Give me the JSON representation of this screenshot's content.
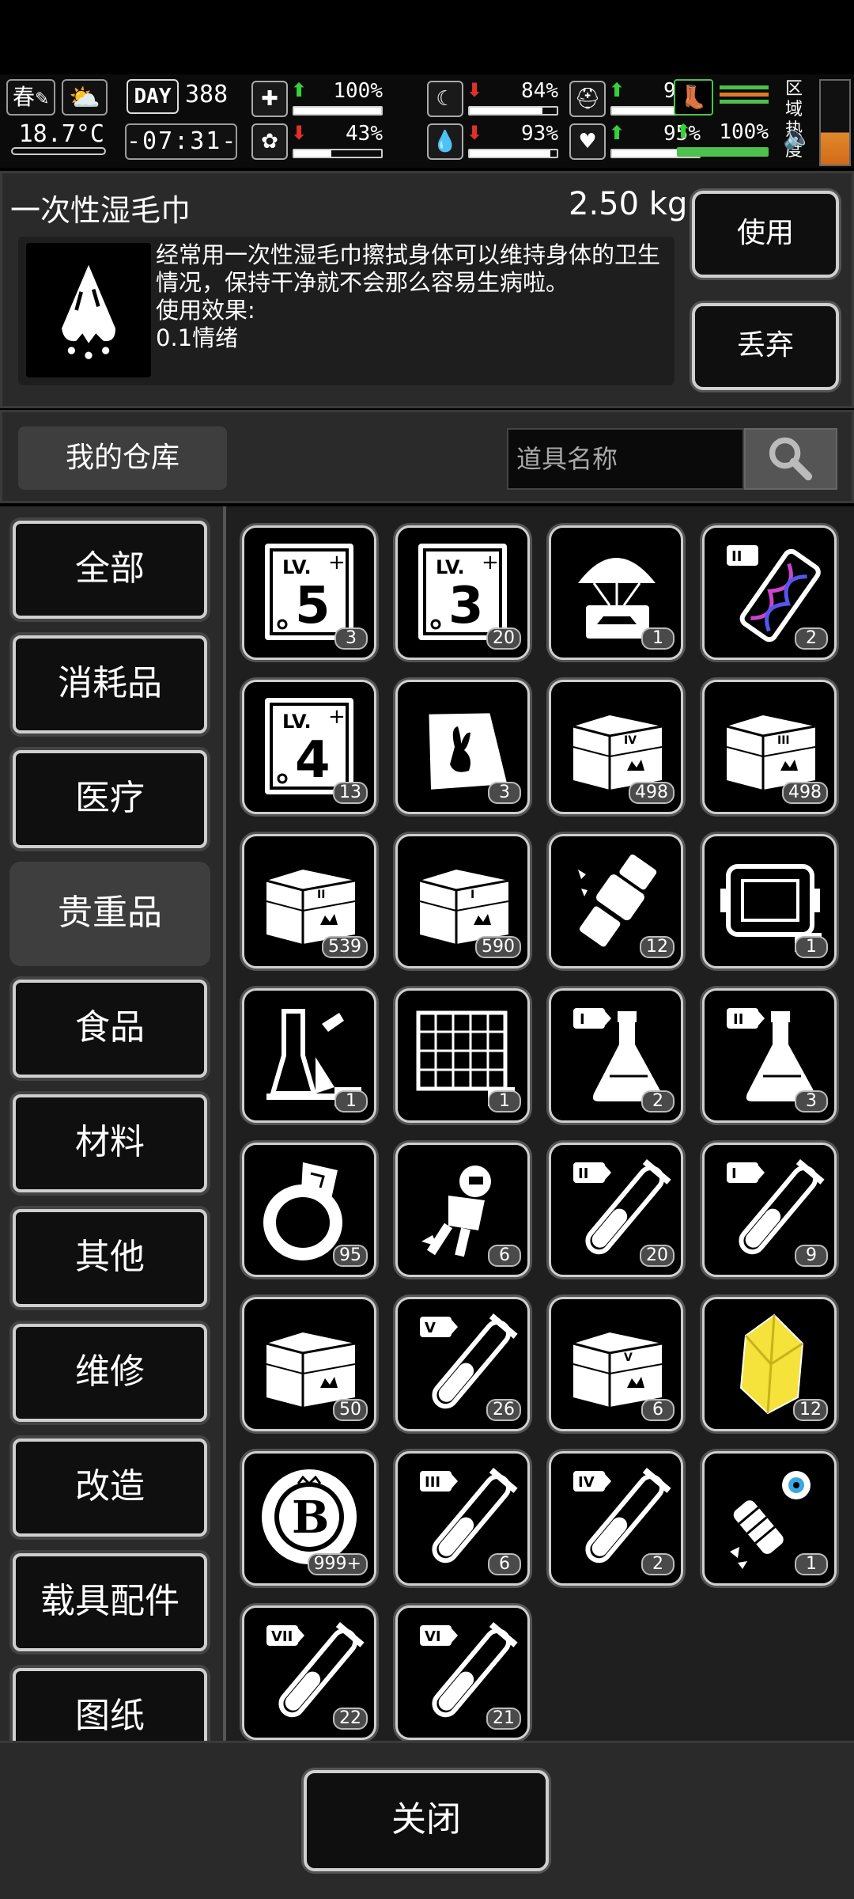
{
  "status": {
    "season": "春",
    "weather_icon": "cloudy-sun-icon",
    "temperature": "18.7°C",
    "day_label": "DAY",
    "day_value": "388",
    "clock": "-07:31-",
    "stats": [
      {
        "icon": "medkit-icon",
        "trend": "up",
        "percent": "100%",
        "level": 1.0
      },
      {
        "icon": "stomach-icon",
        "trend": "down",
        "percent": "84%",
        "level": 0.84
      },
      {
        "icon": "helmet-icon",
        "trend": "up",
        "percent": "92%",
        "level": 0.92
      },
      {
        "icon": "brain-icon",
        "trend": "down",
        "percent": "43%",
        "level": 0.43
      },
      {
        "icon": "water-drop-icon",
        "trend": "down",
        "percent": "93%",
        "level": 0.93
      },
      {
        "icon": "heart-icon",
        "trend": "up",
        "percent": "95%",
        "level": 0.95
      }
    ],
    "stamina": {
      "icon": "boot-icon",
      "trend": "up",
      "percent": "100%",
      "level": 1.0
    },
    "region_label": "区域热度",
    "sound_icon": "speaker-icon",
    "colors": {
      "up": "#37d03a",
      "down": "#e0302a",
      "stamina": "#4dc04d"
    }
  },
  "item": {
    "name": "一次性湿毛巾",
    "weight": "2.50 kg",
    "description": "经常用一次性湿毛巾擦拭身体可以维持身体的卫生情况，保持干净就不会那么容易生病啦。",
    "effect_label": "使用效果:",
    "effect_value": "0.1情绪",
    "use_label": "使用",
    "drop_label": "丢弃"
  },
  "warehouse": {
    "title": "我的仓库",
    "search_placeholder": "道具名称"
  },
  "categories": [
    "全部",
    "消耗品",
    "医疗",
    "贵重品",
    "食品",
    "材料",
    "其他",
    "维修",
    "改造",
    "载具配件",
    "图纸"
  ],
  "active_category": "贵重品",
  "items": [
    {
      "icon": "level-up-ticket-5-icon",
      "count": "3",
      "glyph": "5"
    },
    {
      "icon": "level-up-ticket-3-icon",
      "count": "20",
      "glyph": "3"
    },
    {
      "icon": "airdrop-car-icon",
      "count": "1"
    },
    {
      "icon": "dna-capsule-ii-icon",
      "count": "2"
    },
    {
      "icon": "level-up-ticket-4-icon",
      "count": "13",
      "glyph": "4"
    },
    {
      "icon": "rabbit-bag-icon",
      "count": "3"
    },
    {
      "icon": "crate-iv-icon",
      "count": "498"
    },
    {
      "icon": "crate-iii-icon",
      "count": "498"
    },
    {
      "icon": "crate-ii-icon",
      "count": "539"
    },
    {
      "icon": "crate-i-icon",
      "count": "590"
    },
    {
      "icon": "broken-canister-icon",
      "count": "12"
    },
    {
      "icon": "machine-blueprint-icon",
      "count": "1"
    },
    {
      "icon": "lab-flask-blueprint-icon",
      "count": "1"
    },
    {
      "icon": "grid-blueprint-icon",
      "count": "1"
    },
    {
      "icon": "flask-i-icon",
      "count": "2"
    },
    {
      "icon": "flask-ii-icon",
      "count": "3"
    },
    {
      "icon": "crown-ring-icon",
      "count": "95"
    },
    {
      "icon": "astronaut-icon",
      "count": "6"
    },
    {
      "icon": "test-tube-ii-icon",
      "count": "20"
    },
    {
      "icon": "test-tube-i-icon",
      "count": "9"
    },
    {
      "icon": "crate-special-icon",
      "count": "50"
    },
    {
      "icon": "test-tube-v-icon",
      "count": "26"
    },
    {
      "icon": "crate-v-icon",
      "count": "6"
    },
    {
      "icon": "yellow-crystal-icon",
      "count": "12"
    },
    {
      "icon": "bitcoin-chip-icon",
      "count": "999+",
      "glyph": "B"
    },
    {
      "icon": "test-tube-iii-icon",
      "count": "6"
    },
    {
      "icon": "test-tube-iv-icon",
      "count": "2"
    },
    {
      "icon": "robot-arm-eye-icon",
      "count": "1"
    },
    {
      "icon": "test-tube-vii-icon",
      "count": "22"
    },
    {
      "icon": "test-tube-vi-icon",
      "count": "21"
    }
  ],
  "close_label": "关闭"
}
